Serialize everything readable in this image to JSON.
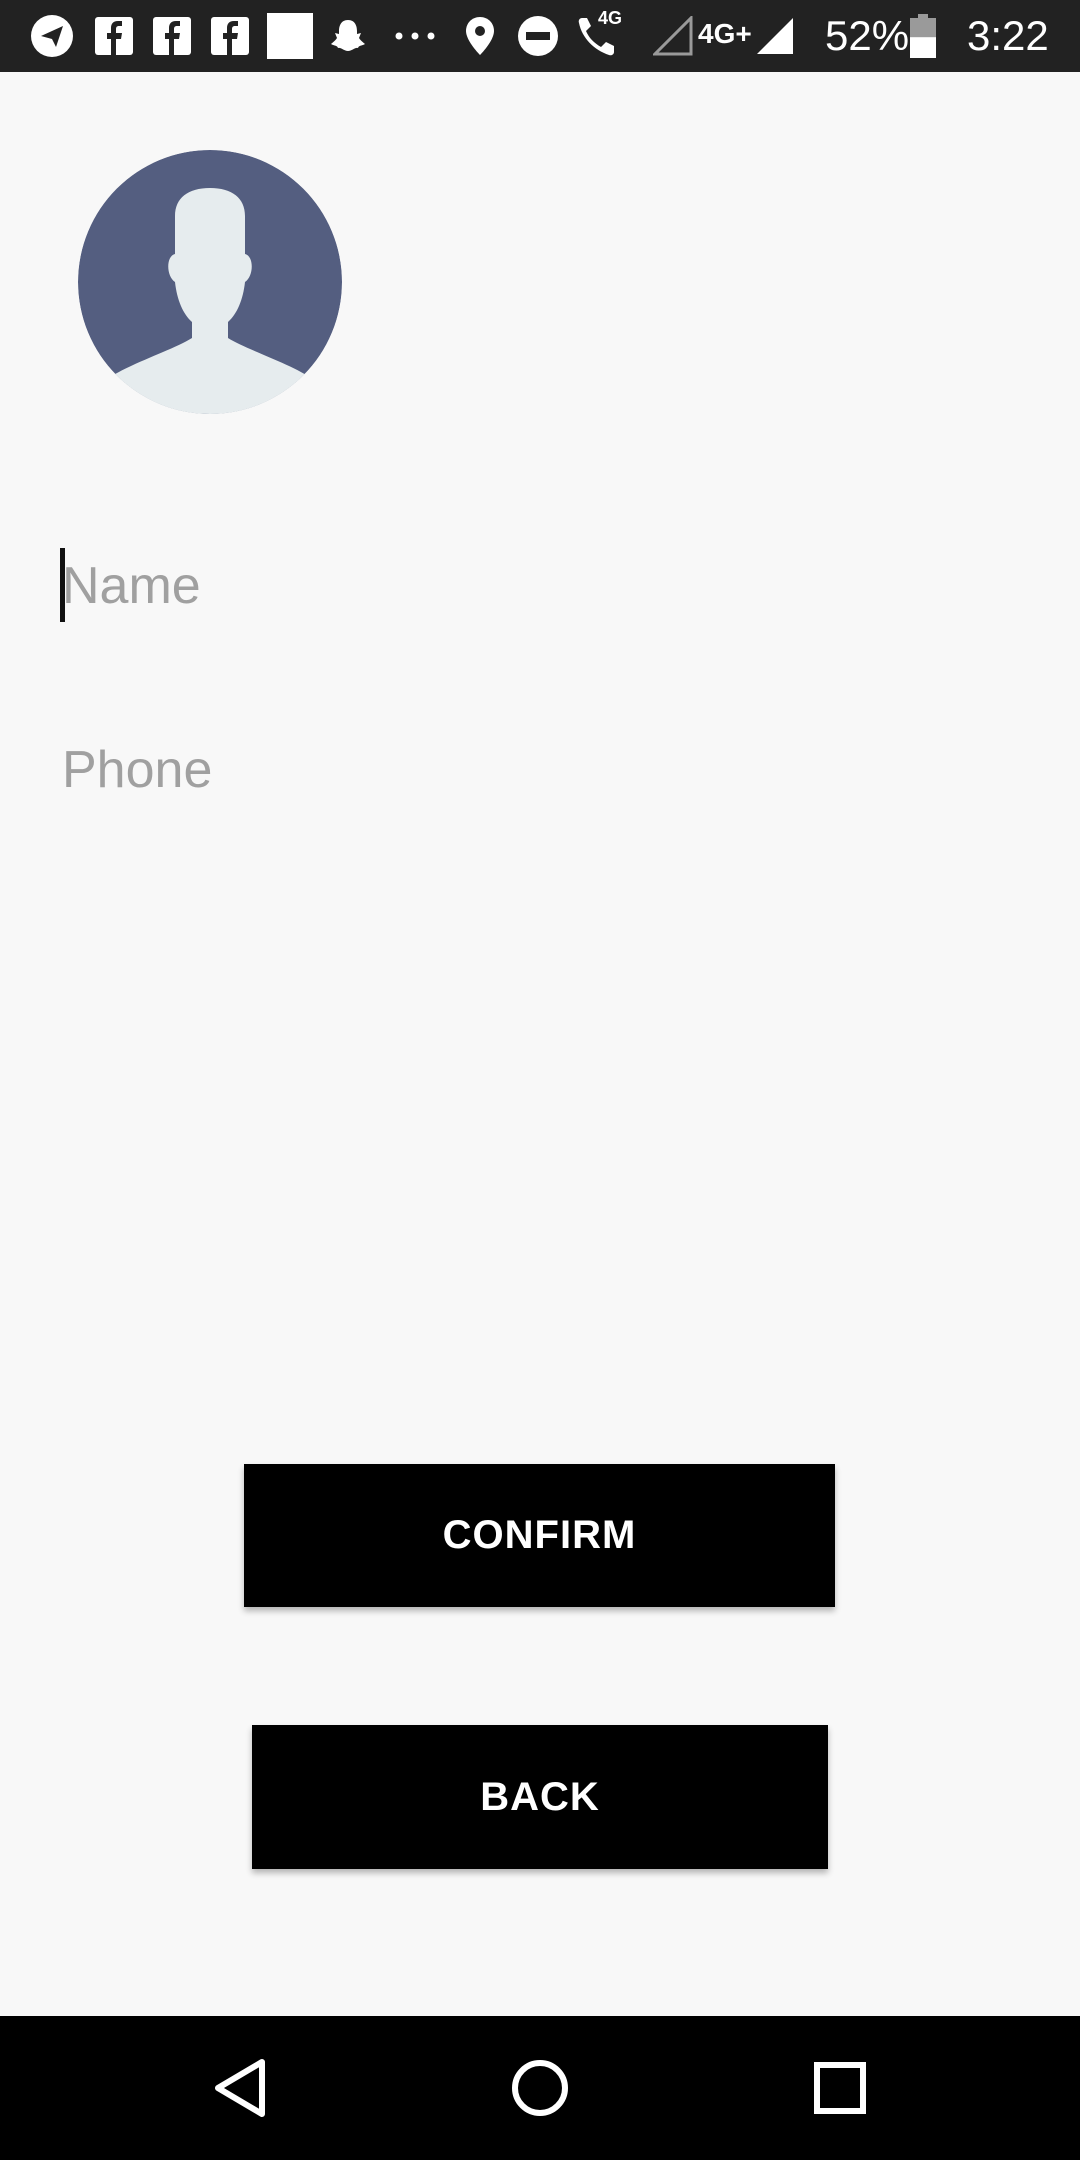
{
  "status_bar": {
    "network_label": "4G+",
    "call_label": "4G",
    "battery_percent": "52%",
    "battery_level": 0.52,
    "time": "3:22",
    "icons": [
      "telegram-icon",
      "facebook-icon",
      "facebook-icon",
      "facebook-icon",
      "blank-square-icon",
      "snapchat-icon",
      "more-dots-icon",
      "location-icon",
      "do-not-disturb-icon",
      "wifi-call-icon",
      "signal-empty-icon",
      "signal-icon",
      "battery-icon"
    ]
  },
  "form": {
    "avatar_icon": "default-user-avatar-icon",
    "name_placeholder": "Name",
    "phone_placeholder": "Phone"
  },
  "buttons": {
    "confirm_label": "CONFIRM",
    "back_label": "BACK"
  },
  "nav_bar": {
    "icons": [
      "back-triangle-icon",
      "home-circle-icon",
      "recents-square-icon"
    ]
  },
  "colors": {
    "avatar_bg": "#545e80",
    "avatar_figure": "#e6ecee",
    "button_bg": "#000000",
    "placeholder": "#a0a0a0"
  }
}
